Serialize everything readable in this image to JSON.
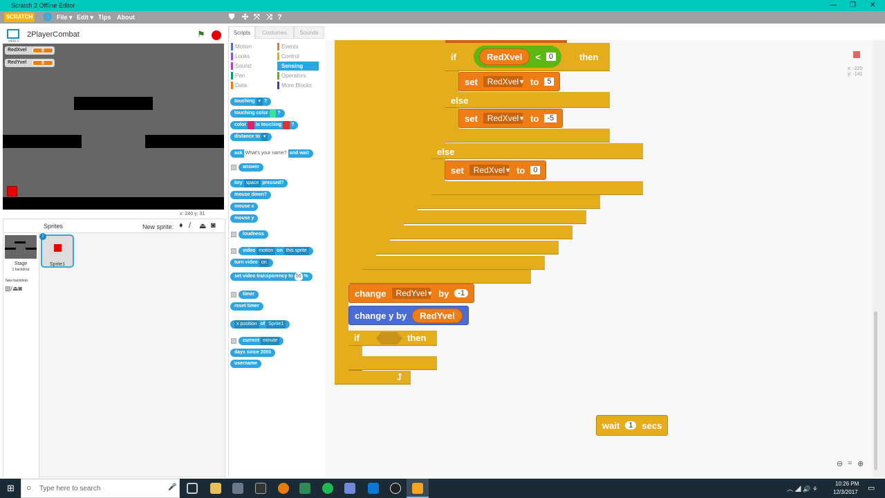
{
  "window": {
    "title": "Scratch 2 Offline Editor"
  },
  "menu": {
    "logo": "SCRATCH",
    "items": [
      "File ▾",
      "Edit ▾",
      "Tips",
      "About"
    ]
  },
  "project": {
    "name": "2PlayerCombat",
    "version": "v439.3"
  },
  "monitors": [
    {
      "name": "RedXvel",
      "value": "0"
    },
    {
      "name": "RedYvel",
      "value": "0"
    }
  ],
  "stage_coords": {
    "x_label": "x:",
    "x": "240",
    "y_label": "y:",
    "y": "31"
  },
  "sprites_panel": {
    "title": "Sprites",
    "new_sprite": "New sprite:",
    "stage_label": "Stage",
    "stage_sub": "1 backdrop",
    "new_backdrop": "New backdrop:",
    "sprites": [
      {
        "name": "Sprite1",
        "selected": true
      }
    ]
  },
  "tabs": [
    "Scripts",
    "Costumes",
    "Sounds"
  ],
  "categories": [
    {
      "label": "Motion",
      "color": "#4a6cd4"
    },
    {
      "label": "Events",
      "color": "#c88330"
    },
    {
      "label": "Looks",
      "color": "#8a55d7"
    },
    {
      "label": "Control",
      "color": "#e1a91a"
    },
    {
      "label": "Sound",
      "color": "#bb42c3"
    },
    {
      "label": "Sensing",
      "color": "#2ca5e2",
      "selected": true
    },
    {
      "label": "Pen",
      "color": "#0e9a6c"
    },
    {
      "label": "Operators",
      "color": "#5cb712"
    },
    {
      "label": "Data",
      "color": "#ee7d16"
    },
    {
      "label": "More Blocks",
      "color": "#632d99"
    }
  ],
  "palette": {
    "touching": "touching",
    "q": "?",
    "touching_color": "touching color",
    "color": "color",
    "is_touching": "is touching",
    "distance_to": "distance to",
    "ask": "ask",
    "ask_default": "What's your name?",
    "and_wait": "and wait",
    "answer": "answer",
    "key": "key",
    "space": "space",
    "pressed": "pressed?",
    "mouse_down": "mouse down?",
    "mouse_x": "mouse x",
    "mouse_y": "mouse y",
    "loudness": "loudness",
    "video": "video",
    "motion": "motion",
    "on": "on",
    "this_sprite": "this sprite",
    "turn_video": "turn video",
    "on_opt": "on",
    "set_video_transparency": "set video transparency to",
    "transparency_val": "50",
    "pct": "%",
    "timer": "timer",
    "reset_timer": "reset timer",
    "x_position": "x position",
    "of": "of",
    "sprite1": "Sprite1",
    "current": "current",
    "minute": "minute",
    "days_since": "days since 2000",
    "username": "username"
  },
  "script": {
    "if": "if",
    "then": "then",
    "else": "else",
    "set": "set",
    "to": "to",
    "change": "change",
    "by": "by",
    "lt": "<",
    "redxvel": "RedXvel",
    "redyvel": "RedYvel",
    "zero": "0",
    "five": "5",
    "neg5": "-5",
    "neg1": "-1",
    "change_y": "change y by",
    "wait": "wait",
    "one": "1",
    "secs": "secs"
  },
  "mouse_readout": {
    "x": "x: -220",
    "y": "y: -141"
  },
  "taskbar": {
    "search_placeholder": "Type here to search",
    "time": "10:26 PM",
    "date": "12/3/2017"
  }
}
